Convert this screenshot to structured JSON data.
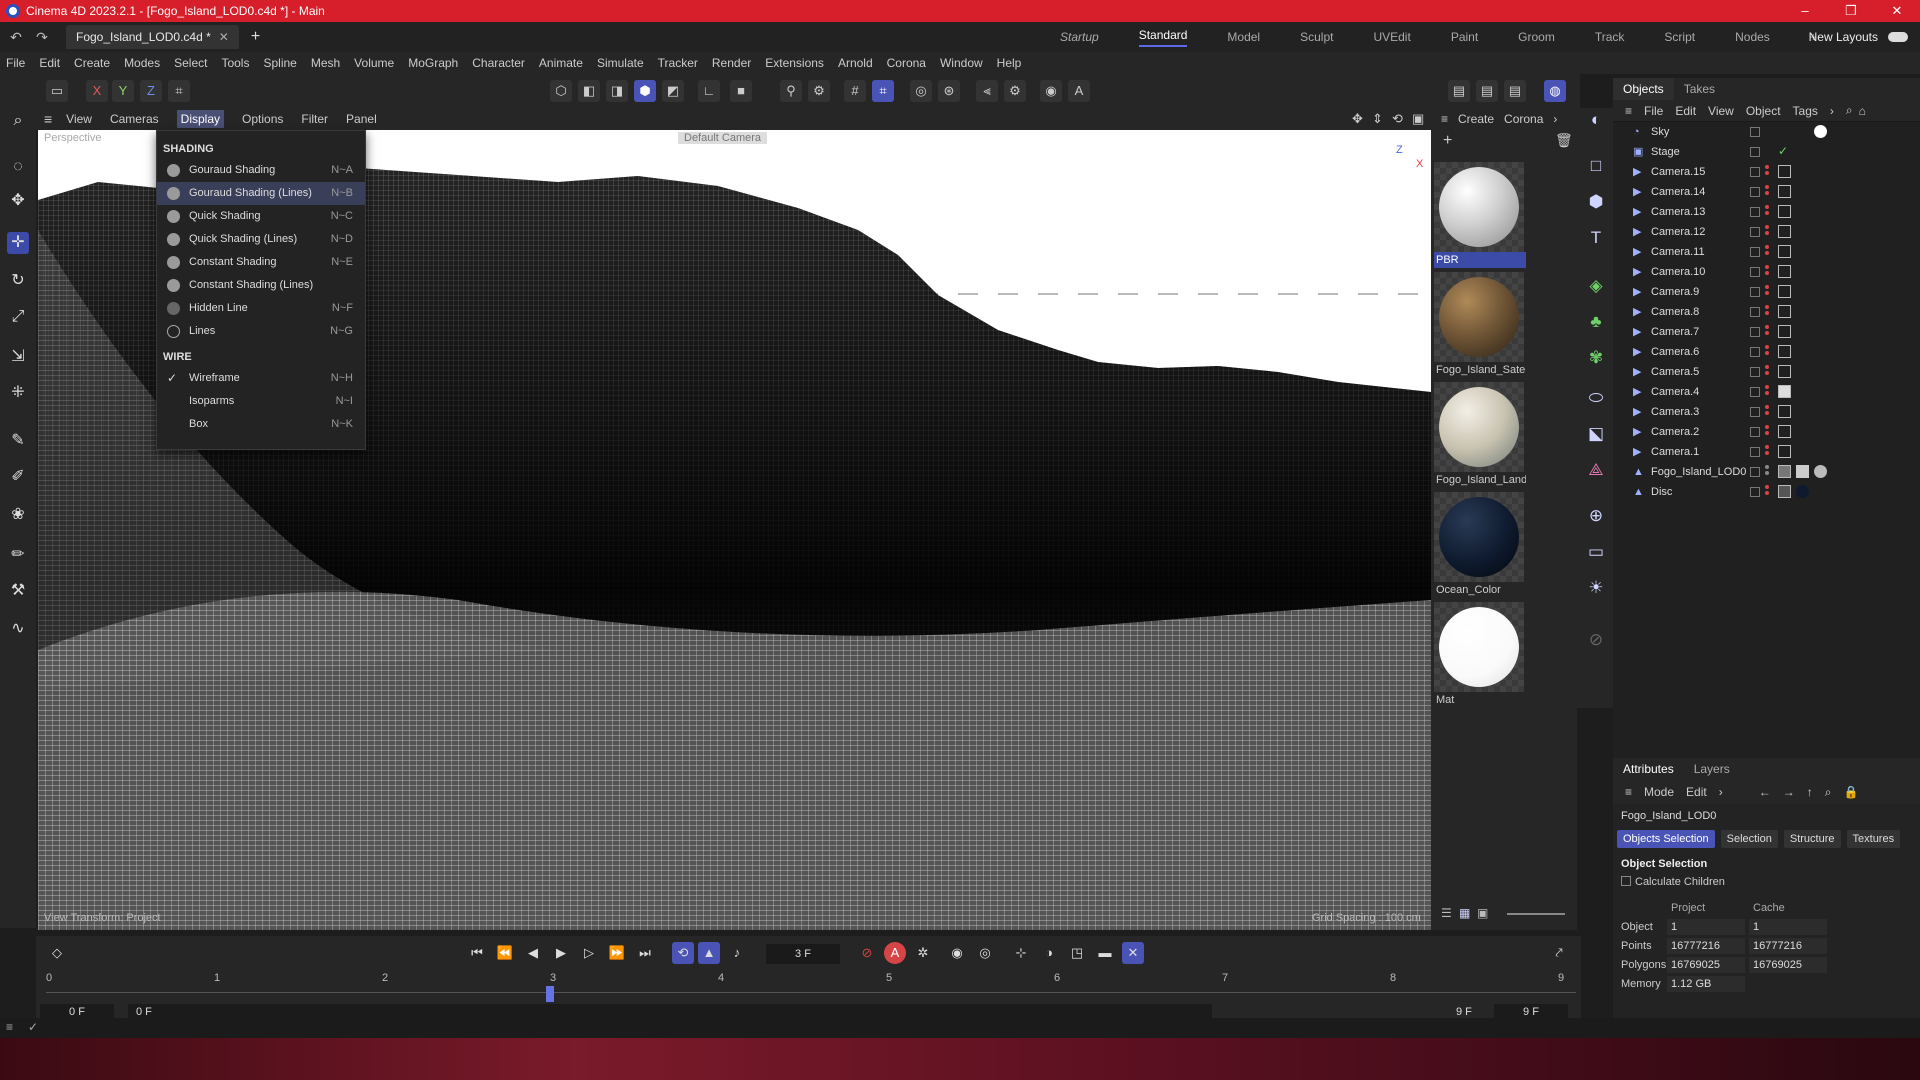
{
  "window": {
    "title": "Cinema 4D 2023.2.1 - [Fogo_Island_LOD0.c4d *] - Main",
    "controls": [
      "–",
      "❐",
      "✕"
    ]
  },
  "tabs": {
    "doc_tab": "Fogo_Island_LOD0.c4d *",
    "layouts": [
      "Startup",
      "Standard",
      "Model",
      "Sculpt",
      "UVEdit",
      "Paint",
      "Groom",
      "Track",
      "Script",
      "Nodes"
    ],
    "active_layout": "Standard",
    "new_layouts": "New Layouts"
  },
  "menubar": [
    "File",
    "Edit",
    "Create",
    "Modes",
    "Select",
    "Tools",
    "Spline",
    "Mesh",
    "Volume",
    "MoGraph",
    "Character",
    "Animate",
    "Simulate",
    "Tracker",
    "Render",
    "Extensions",
    "Arnold",
    "Corona",
    "Window",
    "Help"
  ],
  "toolbar": {
    "axis_x": "X",
    "axis_y": "Y",
    "axis_z": "Z"
  },
  "viewport": {
    "menu": [
      "View",
      "Cameras",
      "Display",
      "Options",
      "Filter",
      "Panel"
    ],
    "active_menu": "Display",
    "camera_label": "Perspective",
    "camera_chip": "Default Camera",
    "bottom_left": "View Transform: Project",
    "bottom_right": "Grid Spacing : 100 cm",
    "axis_z": "Z",
    "axis_x": "X"
  },
  "display_menu": {
    "shading_header": "SHADING",
    "shading": [
      {
        "label": "Gouraud Shading",
        "shortcut": "N~A"
      },
      {
        "label": "Gouraud Shading (Lines)",
        "shortcut": "N~B"
      },
      {
        "label": "Quick Shading",
        "shortcut": "N~C"
      },
      {
        "label": "Quick Shading (Lines)",
        "shortcut": "N~D"
      },
      {
        "label": "Constant Shading",
        "shortcut": "N~E"
      },
      {
        "label": "Constant Shading (Lines)",
        "shortcut": ""
      },
      {
        "label": "Hidden Line",
        "shortcut": "N~F"
      },
      {
        "label": "Lines",
        "shortcut": "N~G"
      }
    ],
    "wire_header": "WIRE",
    "wire": [
      {
        "label": "Wireframe",
        "shortcut": "N~H",
        "checked": true
      },
      {
        "label": "Isoparms",
        "shortcut": "N~I",
        "checked": false
      },
      {
        "label": "Box",
        "shortcut": "N~K",
        "checked": false
      }
    ]
  },
  "materials": {
    "menu": [
      "Create",
      "Corona"
    ],
    "items": [
      {
        "name": "PBR",
        "selected": true,
        "color": "#e8e8e8"
      },
      {
        "name": "Fogo_Island_Satel",
        "selected": false,
        "color": "#6b5234"
      },
      {
        "name": "Fogo_Island_Land",
        "selected": false,
        "color": "#c8c2b0"
      },
      {
        "name": "Ocean_Color",
        "selected": false,
        "color": "#0e1a2e"
      },
      {
        "name": "Mat",
        "selected": false,
        "color": "#ffffff"
      }
    ]
  },
  "objects": {
    "tabs": [
      "Objects",
      "Takes"
    ],
    "menu": [
      "File",
      "Edit",
      "View",
      "Object",
      "Tags"
    ],
    "items": [
      {
        "name": "Sky",
        "icon": "sky-icon"
      },
      {
        "name": "Stage",
        "icon": "stage-icon"
      },
      {
        "name": "Camera.15",
        "icon": "camera-icon"
      },
      {
        "name": "Camera.14",
        "icon": "camera-icon"
      },
      {
        "name": "Camera.13",
        "icon": "camera-icon"
      },
      {
        "name": "Camera.12",
        "icon": "camera-icon"
      },
      {
        "name": "Camera.11",
        "icon": "camera-icon"
      },
      {
        "name": "Camera.10",
        "icon": "camera-icon"
      },
      {
        "name": "Camera.9",
        "icon": "camera-icon"
      },
      {
        "name": "Camera.8",
        "icon": "camera-icon"
      },
      {
        "name": "Camera.7",
        "icon": "camera-icon"
      },
      {
        "name": "Camera.6",
        "icon": "camera-icon"
      },
      {
        "name": "Camera.5",
        "icon": "camera-icon"
      },
      {
        "name": "Camera.4",
        "icon": "camera-icon"
      },
      {
        "name": "Camera.3",
        "icon": "camera-icon"
      },
      {
        "name": "Camera.2",
        "icon": "camera-icon"
      },
      {
        "name": "Camera.1",
        "icon": "camera-icon"
      },
      {
        "name": "Fogo_Island_LOD0",
        "icon": "polygon-object-icon"
      },
      {
        "name": "Disc",
        "icon": "disc-icon"
      }
    ]
  },
  "attributes": {
    "tabs": [
      "Attributes",
      "Layers"
    ],
    "menu": [
      "Mode",
      "Edit"
    ],
    "object_name": "Fogo_Island_LOD0",
    "buttons": [
      "Objects Selection",
      "Selection",
      "Structure",
      "Textures"
    ],
    "section": "Object Selection",
    "calc_children": "Calculate Children",
    "col_project": "Project",
    "col_cache": "Cache",
    "rows": [
      {
        "label": "Object",
        "project": "1",
        "cache": "1"
      },
      {
        "label": "Points",
        "project": "16777216",
        "cache": "16777216"
      },
      {
        "label": "Polygons",
        "project": "16769025",
        "cache": "16769025"
      },
      {
        "label": "Memory",
        "project": "1.12 GB",
        "cache": ""
      }
    ]
  },
  "timeline": {
    "current_frame": "3 F",
    "ticks": [
      "0",
      "1",
      "2",
      "3",
      "4",
      "5",
      "6",
      "7",
      "8",
      "9"
    ],
    "playhead_frame": 3,
    "start": "0 F",
    "range_start": "0 F",
    "range_end": "9 F",
    "end": "9 F"
  }
}
